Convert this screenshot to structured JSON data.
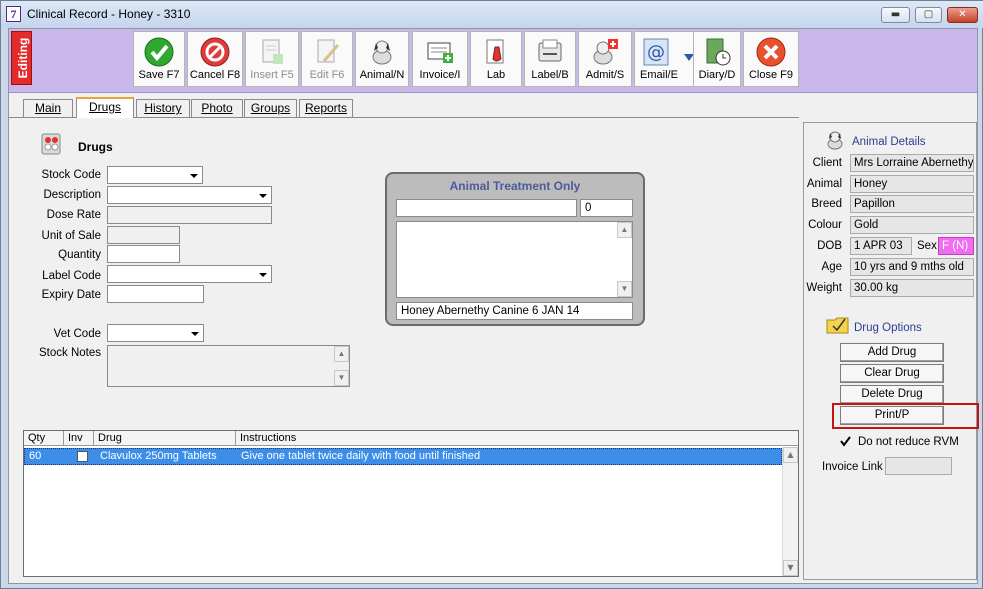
{
  "window": {
    "title": "Clinical Record - Honey - 3310",
    "app_icon": "7",
    "minimize": "▬",
    "maximize": "▢",
    "close": "✕"
  },
  "toolbar": {
    "editing": "Editing",
    "buttons": [
      {
        "label": "Save F7",
        "icon": "save-check-icon"
      },
      {
        "label": "Cancel F8",
        "icon": "cancel-icon"
      },
      {
        "label": "Insert F5",
        "icon": "insert-doc-icon"
      },
      {
        "label": "Edit F6",
        "icon": "edit-doc-icon"
      },
      {
        "label": "Animal/N",
        "icon": "dog-icon"
      },
      {
        "label": "Invoice/I",
        "icon": "invoice-icon"
      },
      {
        "label": "Lab",
        "icon": "lab-flask-icon"
      },
      {
        "label": "Label/B",
        "icon": "label-printer-icon"
      },
      {
        "label": "Admit/S",
        "icon": "admit-dog-icon"
      },
      {
        "label": "Email/E",
        "icon": "email-at-icon"
      },
      {
        "label": "Diary/D",
        "icon": "diary-icon"
      },
      {
        "label": "Close F9",
        "icon": "close-x-icon"
      }
    ]
  },
  "tabs": [
    "Main",
    "Drugs",
    "History",
    "Photo",
    "Groups",
    "Reports"
  ],
  "drugs": {
    "heading": "Drugs",
    "labels": {
      "stock_code": "Stock Code",
      "description": "Description",
      "dose_rate": "Dose Rate",
      "unit_of_sale": "Unit of Sale",
      "quantity": "Quantity",
      "label_code": "Label Code",
      "expiry_date": "Expiry Date",
      "vet_code": "Vet Code",
      "stock_notes": "Stock Notes"
    }
  },
  "treatment": {
    "title": "Animal Treatment Only",
    "count": "0",
    "footer": "Honey Abernethy  Canine 6 JAN 14"
  },
  "grid": {
    "headers": [
      "Qty",
      "Inv",
      "Drug",
      "Instructions"
    ],
    "rows": [
      {
        "qty": "60",
        "drug": "Clavulox 250mg Tablets",
        "instructions": "Give one tablet twice daily with food until finished"
      }
    ]
  },
  "animal": {
    "heading": "Animal Details",
    "client_label": "Client",
    "client": "Mrs Lorraine Abernethy",
    "animal_label": "Animal",
    "animal": "Honey",
    "breed_label": "Breed",
    "breed": "Papillon",
    "colour_label": "Colour",
    "colour": "Gold",
    "dob_label": "DOB",
    "dob": "1 APR 03",
    "sex_label": "Sex",
    "sex": "F (N)",
    "age_label": "Age",
    "age": "10 yrs and 9 mths old",
    "weight_label": "Weight",
    "weight": "30.00 kg"
  },
  "drug_options": {
    "heading": "Drug Options",
    "add": "Add Drug",
    "clear": "Clear Drug",
    "delete": "Delete Drug",
    "print": "Print/P",
    "no_reduce": "Do not reduce RVM",
    "invoice_link": "Invoice Link"
  },
  "colors": {
    "toolbar_bg": "#c9b7ea",
    "editing_red": "#e32b2b",
    "selected_row": "#3d8ee8",
    "sex_badge": "#f06cf0",
    "print_highlight": "#c0141b"
  }
}
